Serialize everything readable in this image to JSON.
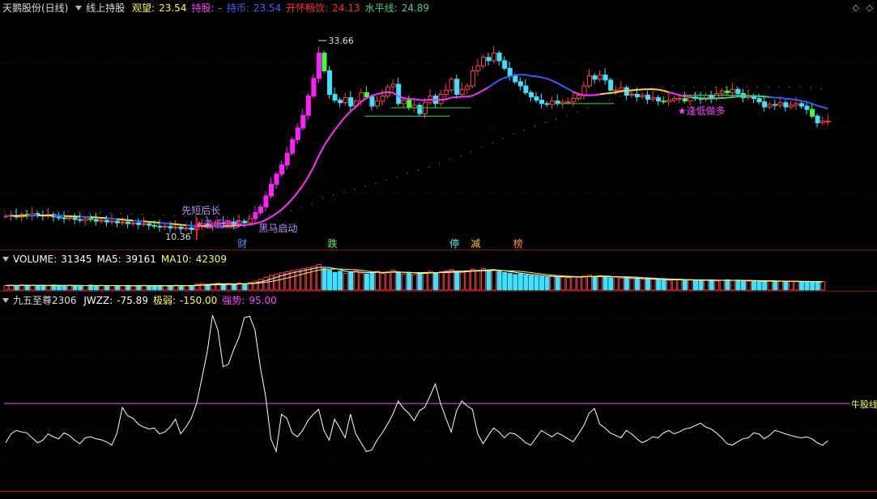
{
  "main": {
    "stock": "天鹅股份(日线)",
    "indicator": "线上持股",
    "items": [
      {
        "label": "观望:",
        "value": "23.54",
        "color": "#ffff40"
      },
      {
        "label": "持股:",
        "value": "-",
        "color": "#ff40ff"
      },
      {
        "label": "持币:",
        "value": "23.54",
        "color": "#4060ff"
      },
      {
        "label": "开怀畅饮:",
        "value": "24.13",
        "color": "#ff3030"
      },
      {
        "label": "水平线:",
        "value": "24.89",
        "color": "#40d080"
      }
    ],
    "high_label": "33.66",
    "low_label": "10.36",
    "annotations": [
      {
        "text": "先短后长",
        "color": "#b890ff"
      },
      {
        "text": "★逢低做多",
        "color": "#ff40ff"
      },
      {
        "text": "黑马启动",
        "color": "#b890ff"
      },
      {
        "text": "★逢低做多",
        "color": "#ff40ff"
      }
    ],
    "tags": [
      {
        "text": "财",
        "color": "#40a0ff"
      },
      {
        "text": "跌",
        "color": "#40ff40"
      },
      {
        "text": "停",
        "color": "#40ffff"
      },
      {
        "text": "减",
        "color": "#ffd040"
      },
      {
        "text": "榜",
        "color": "#ff9040"
      }
    ]
  },
  "volume": {
    "items": [
      {
        "label": "VOLUME:",
        "value": "31345",
        "color": "#ffffff"
      },
      {
        "label": "MA5:",
        "value": "39161",
        "color": "#ffffff"
      },
      {
        "label": "MA10:",
        "value": "42309",
        "color": "#ffff40"
      }
    ]
  },
  "indicator": {
    "name": "九五至尊2306",
    "items": [
      {
        "label": "JWZZ:",
        "value": "-75.89",
        "color": "#ffffff"
      },
      {
        "label": "极弱:",
        "value": "-150.00",
        "color": "#ffff40"
      },
      {
        "label": "强势:",
        "value": "95.00",
        "color": "#ff40ff"
      }
    ],
    "line_label": "牛股线",
    "line_color": "#ff40ff"
  },
  "chart_data": [
    {
      "type": "candlestick",
      "title": "天鹅股份(日线)",
      "max_label": "33.66",
      "min_label": "10.36",
      "close": [
        12.2,
        12.3,
        12.1,
        12.4,
        12.2,
        12.5,
        12.3,
        12.2,
        12.4,
        12.1,
        12.0,
        11.9,
        12.0,
        11.8,
        11.7,
        11.9,
        11.8,
        11.6,
        11.7,
        11.5,
        11.6,
        11.4,
        11.5,
        11.3,
        11.4,
        11.2,
        11.3,
        11.1,
        11.0,
        10.9,
        11.0,
        10.8,
        10.9,
        10.7,
        10.8,
        10.6,
        11.1,
        11.3,
        11.0,
        11.2,
        11.4,
        11.3,
        11.5,
        11.2,
        11.6,
        11.4,
        11.9,
        12.6,
        13.3,
        14.6,
        16.0,
        17.2,
        18.3,
        19.7,
        21.3,
        22.7,
        24.2,
        26.5,
        28.6,
        31.6,
        29.5,
        26.7,
        26.0,
        25.7,
        26.3,
        25.3,
        25.9,
        26.9,
        26.4,
        25.3,
        25.9,
        26.5,
        27.6,
        27.9,
        25.6,
        26.0,
        25.1,
        25.4,
        24.4,
        25.7,
        26.5,
        25.6,
        26.7,
        27.2,
        28.5,
        26.7,
        27.3,
        27.7,
        29.5,
        30.1,
        31.1,
        30.7,
        31.6,
        30.7,
        29.8,
        28.9,
        28.2,
        27.7,
        26.9,
        26.4,
        26.0,
        25.6,
        25.5,
        25.9,
        25.6,
        25.8,
        25.8,
        26.2,
        26.6,
        27.7,
        28.9,
        28.5,
        29.0,
        28.4,
        27.2,
        27.2,
        27.5,
        26.6,
        26.7,
        26.4,
        26.6,
        26.1,
        26.3,
        25.9,
        25.8,
        26.0,
        26.2,
        26.2,
        25.9,
        26.4,
        26.2,
        26.1,
        26.6,
        26.2,
        26.8,
        27.1,
        26.9,
        27.3,
        26.8,
        26.3,
        26.5,
        26.2,
        25.8,
        25.2,
        25.5,
        25.4,
        25.7,
        25.2,
        25.4,
        25.6,
        25.3,
        24.9,
        24.1,
        23.3,
        23.5,
        23.5
      ],
      "ylim": [
        9.0,
        36.0
      ]
    },
    {
      "type": "bar",
      "title": "VOLUME",
      "volume": [
        17000,
        18000,
        16000,
        19000,
        17000,
        18000,
        16500,
        17500,
        16000,
        18500,
        17000,
        16000,
        18000,
        15500,
        17000,
        16500,
        18000,
        15000,
        17500,
        16000,
        17000,
        15500,
        16500,
        17000,
        15000,
        16000,
        17500,
        15500,
        16000,
        17000,
        15000,
        16500,
        18000,
        15500,
        17000,
        16000,
        22000,
        24000,
        21000,
        23000,
        25000,
        22000,
        24000,
        20000,
        26000,
        23000,
        28000,
        33000,
        40000,
        48000,
        55000,
        60000,
        64000,
        68000,
        72000,
        76000,
        80000,
        84000,
        88000,
        95000,
        80000,
        74000,
        66000,
        70000,
        62000,
        68000,
        72000,
        64000,
        60000,
        66000,
        70000,
        62000,
        68000,
        74000,
        66000,
        60000,
        64000,
        58000,
        62000,
        66000,
        70000,
        64000,
        68000,
        72000,
        76000,
        70000,
        66000,
        72000,
        78000,
        74000,
        80000,
        72000,
        76000,
        70000,
        66000,
        62000,
        58000,
        60000,
        56000,
        54000,
        52000,
        50000,
        48000,
        52000,
        50000,
        48000,
        46000,
        50000,
        48000,
        52000,
        56000,
        50000,
        54000,
        50000,
        46000,
        48000,
        44000,
        46000,
        42000,
        44000,
        40000,
        42000,
        40000,
        38000,
        40000,
        36000,
        38000,
        40000,
        36000,
        38000,
        35000,
        37000,
        36000,
        38000,
        34000,
        36000,
        38000,
        35000,
        37000,
        34000,
        33000,
        35000,
        33000,
        32000,
        34000,
        32000,
        33000,
        31000,
        33000,
        32000,
        30000,
        32000,
        31000,
        30000,
        31345
      ],
      "ylim": [
        0,
        100000
      ]
    },
    {
      "type": "line",
      "title": "九五至尊2306",
      "series": [
        {
          "name": "JWZZ",
          "values": [
            -80,
            -62,
            -55,
            -58,
            -60,
            -70,
            -80,
            -75,
            -62,
            -68,
            -72,
            -60,
            -65,
            -75,
            -82,
            -70,
            -68,
            -72,
            -74,
            -78,
            -85,
            -60,
            -8,
            -25,
            -30,
            -42,
            -48,
            -52,
            -50,
            -62,
            -58,
            -48,
            -32,
            -62,
            -48,
            -30,
            0,
            52,
            105,
            180,
            150,
            75,
            80,
            110,
            135,
            175,
            178,
            150,
            75,
            15,
            -72,
            -98,
            -22,
            -30,
            -60,
            -68,
            -55,
            -35,
            -22,
            -12,
            -55,
            -75,
            -32,
            -50,
            -70,
            -22,
            -62,
            -80,
            -98,
            -95,
            -75,
            -60,
            -42,
            -22,
            5,
            -10,
            -20,
            -35,
            -15,
            -8,
            15,
            40,
            0,
            -30,
            -58,
            -15,
            5,
            -5,
            -12,
            -62,
            -82,
            -65,
            -50,
            -58,
            -70,
            -60,
            -62,
            -70,
            -80,
            -85,
            -70,
            -55,
            -62,
            -68,
            -60,
            -65,
            -72,
            -78,
            -62,
            -45,
            -20,
            -10,
            -42,
            -50,
            -60,
            -65,
            -70,
            -55,
            -62,
            -72,
            -80,
            -75,
            -68,
            -70,
            -60,
            -55,
            -62,
            -58,
            -52,
            -50,
            -45,
            -40,
            -48,
            -52,
            -60,
            -70,
            -82,
            -85,
            -78,
            -72,
            -70,
            -60,
            -62,
            -72,
            -65,
            -55,
            -58,
            -62,
            -65,
            -68,
            -70,
            -68,
            -72,
            -80,
            -85,
            -75.89
          ]
        }
      ],
      "hlines": [
        {
          "label": "牛股线",
          "value": 0
        }
      ],
      "ylim": [
        -170,
        200
      ]
    }
  ]
}
